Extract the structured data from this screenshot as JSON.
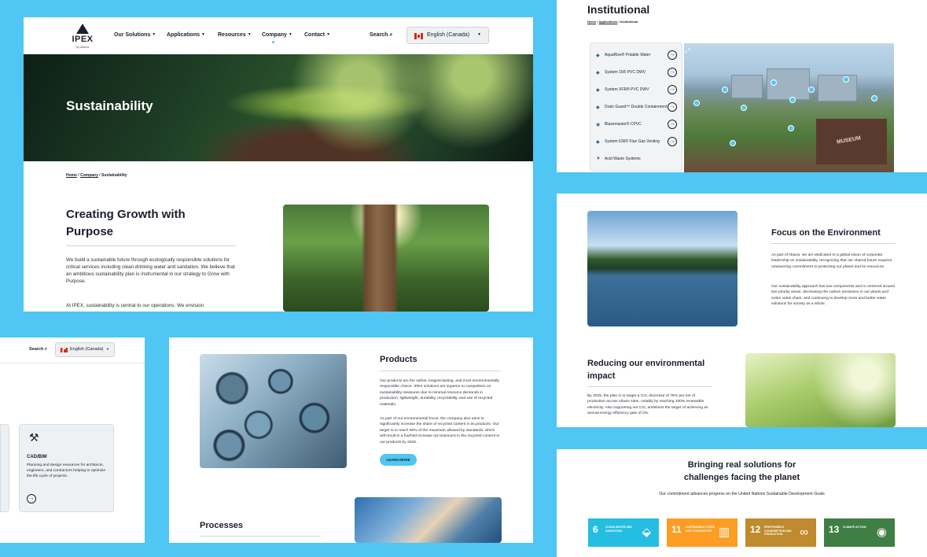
{
  "main": {
    "nav": {
      "logo": "IPEX",
      "logo_sub": "by Aliaxis",
      "items": [
        "Our Solutions",
        "Applications",
        "Resources",
        "Company",
        "Contact"
      ],
      "search": "Search",
      "language": "English (Canada)"
    },
    "hero_title": "Sustainability",
    "breadcrumb": {
      "home": "Home",
      "company": "Company",
      "current": "Sustainability"
    },
    "heading": "Creating Growth with Purpose",
    "para1": "We build a sustainable future through ecologically responsible solutions for critical services including clean drinking water and sanitation. We believe that an ambitious sustainability plan is instrumental in our strategy to Grow with Purpose.",
    "para2": "At IPEX, sustainability is central to our operations. We envision"
  },
  "institutional": {
    "title": "Institutional",
    "breadcrumb": {
      "home": "Home",
      "applications": "Applications",
      "current": "Institutional"
    },
    "menu": [
      "AquaRise® Potable Water",
      "System 15® PVC DWV",
      "System XFR® PVC DWV",
      "Drain Guard™ Double Containment",
      "Blazemaster® CPVC",
      "System 636® Flue Gas Venting",
      "Acid Waste Systems"
    ],
    "building_sign": "MUSEUM"
  },
  "environment": {
    "heading": "Focus on the Environment",
    "para1": "As part of Aliaxis, we are dedicated to a global vision of corporate leadership on sustainability, recognizing that our shared future requires unwavering commitment to protecting our planet and its resources.",
    "para2": "Our sustainability approach has two components and is centered around two priority areas: decreasing the carbon emissions in our plants and entire value chain, and continuing to develop more and better water solutions for society as a whole.",
    "reduce_heading": "Reducing our environmental impact",
    "reduce_para": "By 2025, the plan is to target a CO₂ decrease of 75% per ton of production across Aliaxis sites, notably by reaching 100% renewable electricity. Also supporting our CO₂ ambitions the target of achieving an annual energy efficiency gain of 3%."
  },
  "sdg": {
    "title": "Bringing real solutions for challenges facing the planet",
    "subtitle": "Our commitment advances progress on the United Nations Sustainable Development Goals",
    "tiles": [
      {
        "num": "6",
        "text": "CLEAN WATER AND SANITATION",
        "color": "#26bde2",
        "icon": "water-drop-icon"
      },
      {
        "num": "11",
        "text": "SUSTAINABLE CITIES AND COMMUNITIES",
        "color": "#fd9d24",
        "icon": "city-buildings-icon"
      },
      {
        "num": "12",
        "text": "RESPONSIBLE CONSUMPTION AND PRODUCTION",
        "color": "#bf8b2e",
        "icon": "infinity-icon"
      },
      {
        "num": "13",
        "text": "CLIMATE ACTION",
        "color": "#3f7e44",
        "icon": "eye-globe-icon"
      }
    ]
  },
  "resources": {
    "search": "Search",
    "language": "English (Canada)",
    "card_title": "CAD/BIM",
    "card_desc": "Planning and design resources for architects, engineers, and contractors helping to optimize the life cycle of projects."
  },
  "products": {
    "heading": "Products",
    "para1": "Our products are the safest, longest-lasting, and most environmentally responsible choice. IPEX solutions are superior to competitors on sustainability measures due to minimal resource demands in production, lightweight, durability, recyclability, and use of recycled materials.",
    "para2": "As part of our environmental focus, the company also aims to significantly increase the share of recycled content in its products. Our target is to reach 50% of the maximum allowed by standards, which will result in a fourfold increase (at minimum) in the recycled content in our products by 2025.",
    "button": "LEARN MORE",
    "processes_heading": "Processes"
  }
}
